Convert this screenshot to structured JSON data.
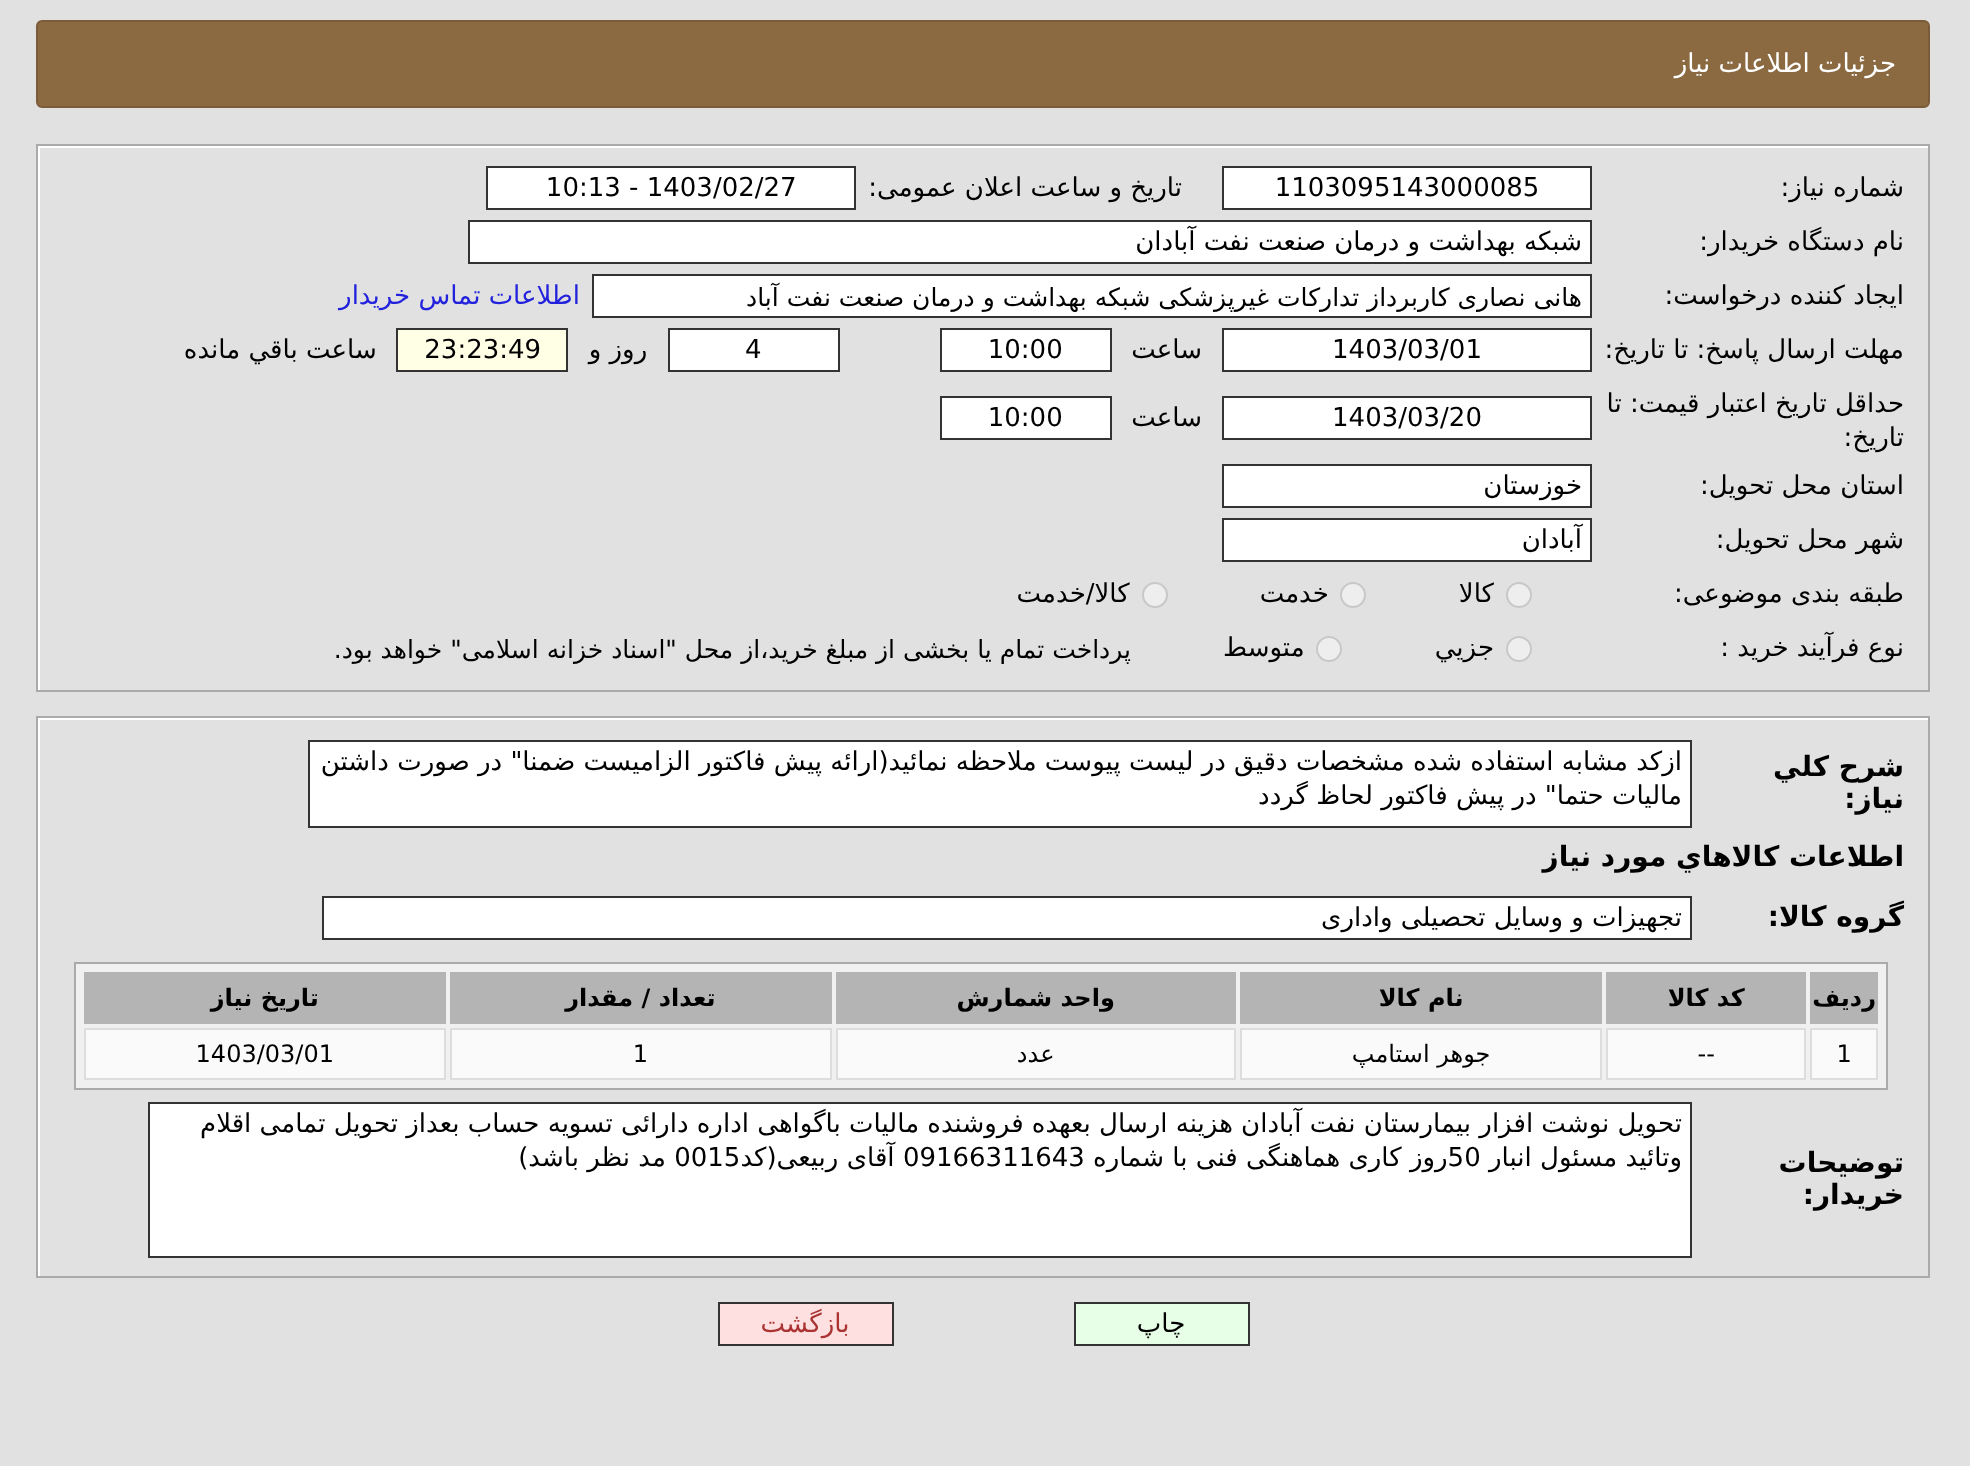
{
  "header": {
    "title": "جزئیات اطلاعات نیاز"
  },
  "info": {
    "need_number_label": "شماره نیاز:",
    "need_number": "1103095143000085",
    "announce_label": "تاریخ و ساعت اعلان عمومی:",
    "announce_value": "1403/02/27 - 10:13",
    "buyer_org_label": "نام دستگاه خریدار:",
    "buyer_org": "شبکه بهداشت و درمان صنعت نفت آبادان",
    "creator_label": "ایجاد کننده درخواست:",
    "creator": "هانی نصاری کاربرداز تدارکات غیرپزشکی شبکه بهداشت و درمان صنعت نفت آباد",
    "contact_link": "اطلاعات تماس خریدار",
    "reply_deadline_label": "مهلت ارسال پاسخ: تا تاریخ:",
    "reply_date": "1403/03/01",
    "reply_time_label": "ساعت",
    "reply_time": "10:00",
    "days": "4",
    "days_label": "روز و",
    "remaining": "23:23:49",
    "remaining_label": "ساعت باقي مانده",
    "validity_label": "حداقل تاریخ اعتبار قیمت: تا تاریخ:",
    "validity_date": "1403/03/20",
    "validity_time_label": "ساعت",
    "validity_time": "10:00",
    "province_label": "استان محل تحویل:",
    "province": "خوزستان",
    "city_label": "شهر محل تحویل:",
    "city": "آبادان",
    "category_label": "طبقه بندی موضوعی:",
    "categories": [
      {
        "label": "کالا",
        "selected": false
      },
      {
        "label": "خدمت",
        "selected": false
      },
      {
        "label": "کالا/خدمت",
        "selected": false
      }
    ],
    "process_label": "نوع فرآیند خرید :",
    "processes": [
      {
        "label": "جزيي",
        "selected": false
      },
      {
        "label": "متوسط",
        "selected": false
      }
    ],
    "process_note": "پرداخت تمام یا بخشی از مبلغ خرید،از محل \"اسناد خزانه اسلامی\" خواهد بود."
  },
  "details": {
    "description_label": "شرح کلي نیاز:",
    "description": "ازکد مشابه استفاده شده مشخصات دقیق در لیست پیوست ملاحظه نمائید(ارائه پیش فاکتور الزامیست ضمنا\" در صورت داشتن مالیات حتما\" در پیش فاکتور لحاظ گردد",
    "goods_heading": "اطلاعات کالاهاي مورد نیاز",
    "group_label": "گروه کالا:",
    "group": "تجهیزات و وسایل تحصیلی واداری",
    "table": {
      "columns": [
        "ردیف",
        "کد کالا",
        "نام کالا",
        "واحد شمارش",
        "تعداد / مقدار",
        "تاریخ نیاز"
      ],
      "rows": [
        [
          "1",
          "--",
          "جوهر استامپ",
          "عدد",
          "1",
          "1403/03/01"
        ]
      ]
    },
    "notes_label": "توضیحات خریدار:",
    "notes": "تحویل نوشت افزار بیمارستان نفت آبادان هزینه ارسال بعهده فروشنده مالیات باگواهی اداره دارائی تسویه حساب بعداز تحویل تمامی اقلام وتائید مسئول انبار 50روز کاری هماهنگی فنی با شماره 09166311643 آقای ربیعی(کد0015 مد نظر باشد)"
  },
  "buttons": [
    {
      "kind": "print",
      "label": "چاپ"
    },
    {
      "kind": "back",
      "label": "بازگشت"
    }
  ]
}
